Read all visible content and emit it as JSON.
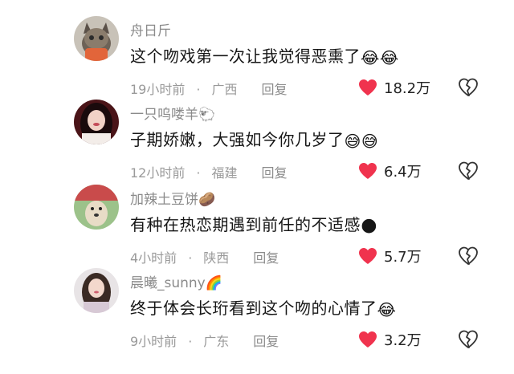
{
  "comments": [
    {
      "username": "舟日斤",
      "text": "这个吻戏第一次让我觉得恶熏了",
      "emoji_text": "😂😂",
      "time": "19小时前",
      "location": "广西",
      "reply": "回复",
      "likes": "18.2万",
      "avatar_icon": "cat-avatar-icon",
      "username_emoji": ""
    },
    {
      "username": "一只呜喽羊",
      "text": "子期娇嫩，大强如今你几岁了",
      "emoji_text": "😅😅",
      "time": "12小时前",
      "location": "福建",
      "reply": "回复",
      "likes": "6.4万",
      "avatar_icon": "girl-avatar-icon",
      "username_emoji": "🐑"
    },
    {
      "username": "加辣土豆饼",
      "text": "有种在热恋期遇到前任的不适感",
      "emoji_text": "🌑",
      "time": "4小时前",
      "location": "陕西",
      "reply": "回复",
      "likes": "5.7万",
      "avatar_icon": "dog-avatar-icon",
      "username_emoji": "🥔"
    },
    {
      "username": "晨曦_sunny",
      "text": "终于体会长珩看到这个吻的心情了",
      "emoji_text": "😂",
      "time": "9小时前",
      "location": "广东",
      "reply": "回复",
      "likes": "3.2万",
      "avatar_icon": "woman-avatar-icon",
      "username_emoji": "🌈"
    }
  ],
  "colors": {
    "like_heart": "#f0334e",
    "meta_text": "#9a9a9a",
    "username": "#8b8b8b"
  }
}
